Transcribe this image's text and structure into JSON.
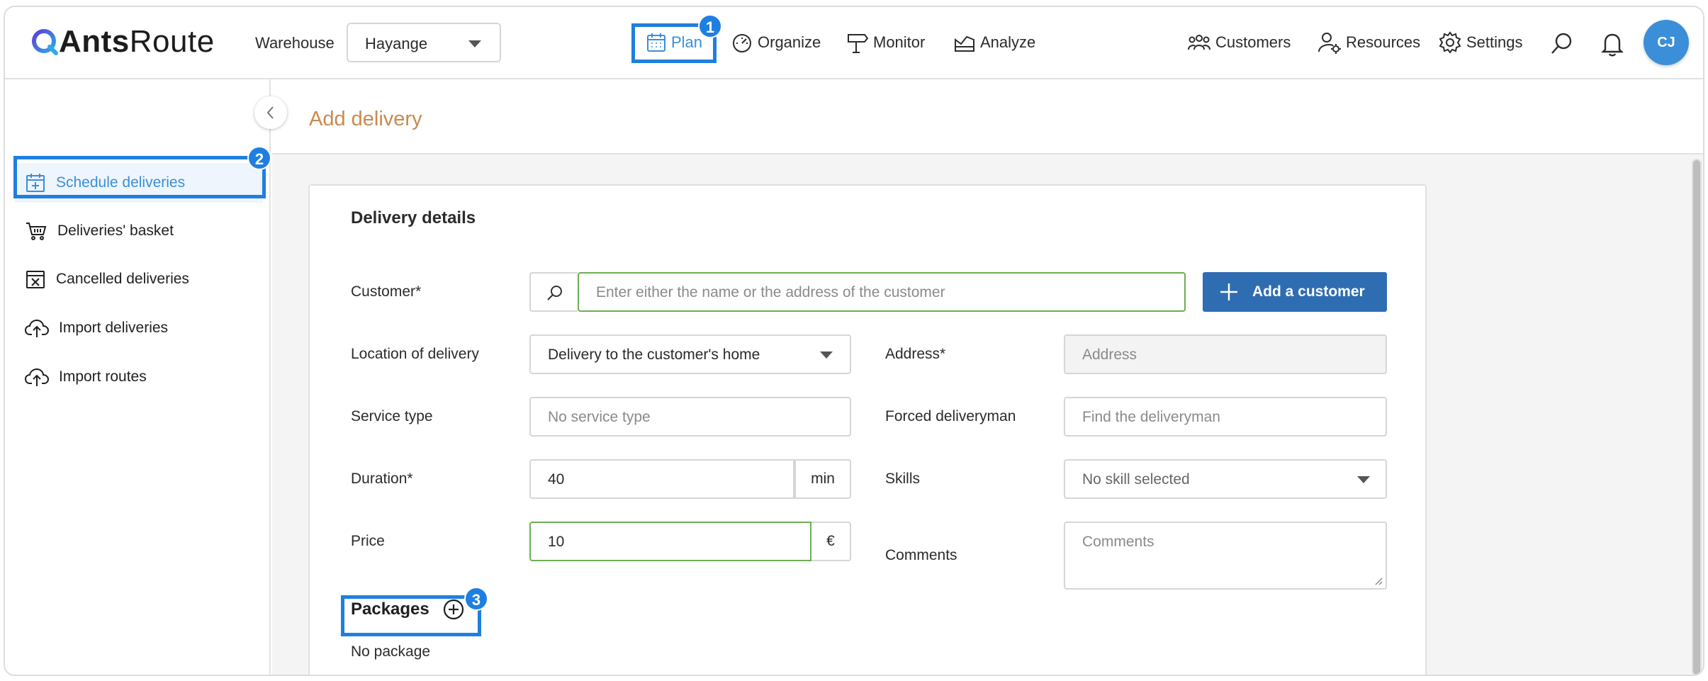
{
  "app": {
    "logo_bold": "Ants",
    "logo_light": "Route",
    "user_initials": "CJ"
  },
  "header": {
    "warehouse_label": "Warehouse",
    "warehouse_value": "Hayange",
    "nav": [
      {
        "label": "Plan",
        "icon": "calendar-icon",
        "active": true
      },
      {
        "label": "Organize",
        "icon": "speedometer-icon"
      },
      {
        "label": "Monitor",
        "icon": "signpost-icon"
      },
      {
        "label": "Analyze",
        "icon": "chart-icon"
      }
    ],
    "right_nav": [
      {
        "label": "Customers",
        "icon": "people-icon"
      },
      {
        "label": "Resources",
        "icon": "user-gear-icon"
      },
      {
        "label": "Settings",
        "icon": "gear-icon"
      }
    ]
  },
  "sidebar": {
    "items": [
      {
        "label": "Schedule deliveries",
        "icon": "calendar-plus-icon",
        "active": true
      },
      {
        "label": "Deliveries' basket",
        "icon": "basket-icon"
      },
      {
        "label": "Cancelled deliveries",
        "icon": "calendar-x-icon"
      },
      {
        "label": "Import deliveries",
        "icon": "cloud-upload-icon"
      },
      {
        "label": "Import routes",
        "icon": "cloud-upload-icon"
      }
    ]
  },
  "page": {
    "title": "Add delivery"
  },
  "form": {
    "section_title": "Delivery details",
    "customer_label": "Customer*",
    "customer_placeholder": "Enter either the name or the address of the customer",
    "add_customer_label": "Add a customer",
    "location_label": "Location of delivery",
    "location_value": "Delivery to the customer's home",
    "address_label": "Address*",
    "address_placeholder": "Address",
    "service_label": "Service type",
    "service_placeholder": "No service type",
    "deliveryman_label": "Forced deliveryman",
    "deliveryman_placeholder": "Find the deliveryman",
    "duration_label": "Duration*",
    "duration_value": "40",
    "duration_unit": "min",
    "skills_label": "Skills",
    "skills_value": "No skill selected",
    "price_label": "Price",
    "price_value": "10",
    "price_unit": "€",
    "comments_label": "Comments",
    "comments_placeholder": "Comments",
    "packages_title": "Packages",
    "packages_empty": "No package"
  },
  "annotations": {
    "badge_1": "1",
    "badge_2": "2",
    "badge_3": "3",
    "highlight_color": "#1f7fe0"
  }
}
